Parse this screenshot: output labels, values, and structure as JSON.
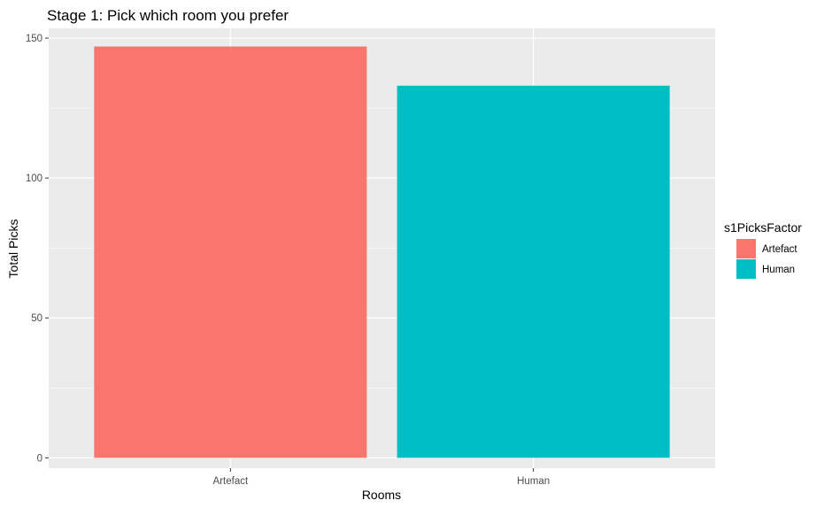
{
  "chart_data": {
    "type": "bar",
    "title": "Stage 1: Pick which room you prefer",
    "xlabel": "Rooms",
    "ylabel": "Total Picks",
    "categories": [
      "Artefact",
      "Human"
    ],
    "values": [
      147,
      133
    ],
    "colors": [
      "#F8766D",
      "#00BFC4"
    ],
    "ylim": [
      0,
      153.5
    ],
    "yticks": [
      0,
      50,
      100,
      150
    ],
    "yticklabels": [
      "0",
      "50",
      "100",
      "150"
    ],
    "grid": true,
    "panel_background": "#EBEBEB",
    "legend": {
      "title": "s1PicksFactor",
      "placement": "right",
      "entries": [
        "Artefact",
        "Human"
      ]
    }
  }
}
